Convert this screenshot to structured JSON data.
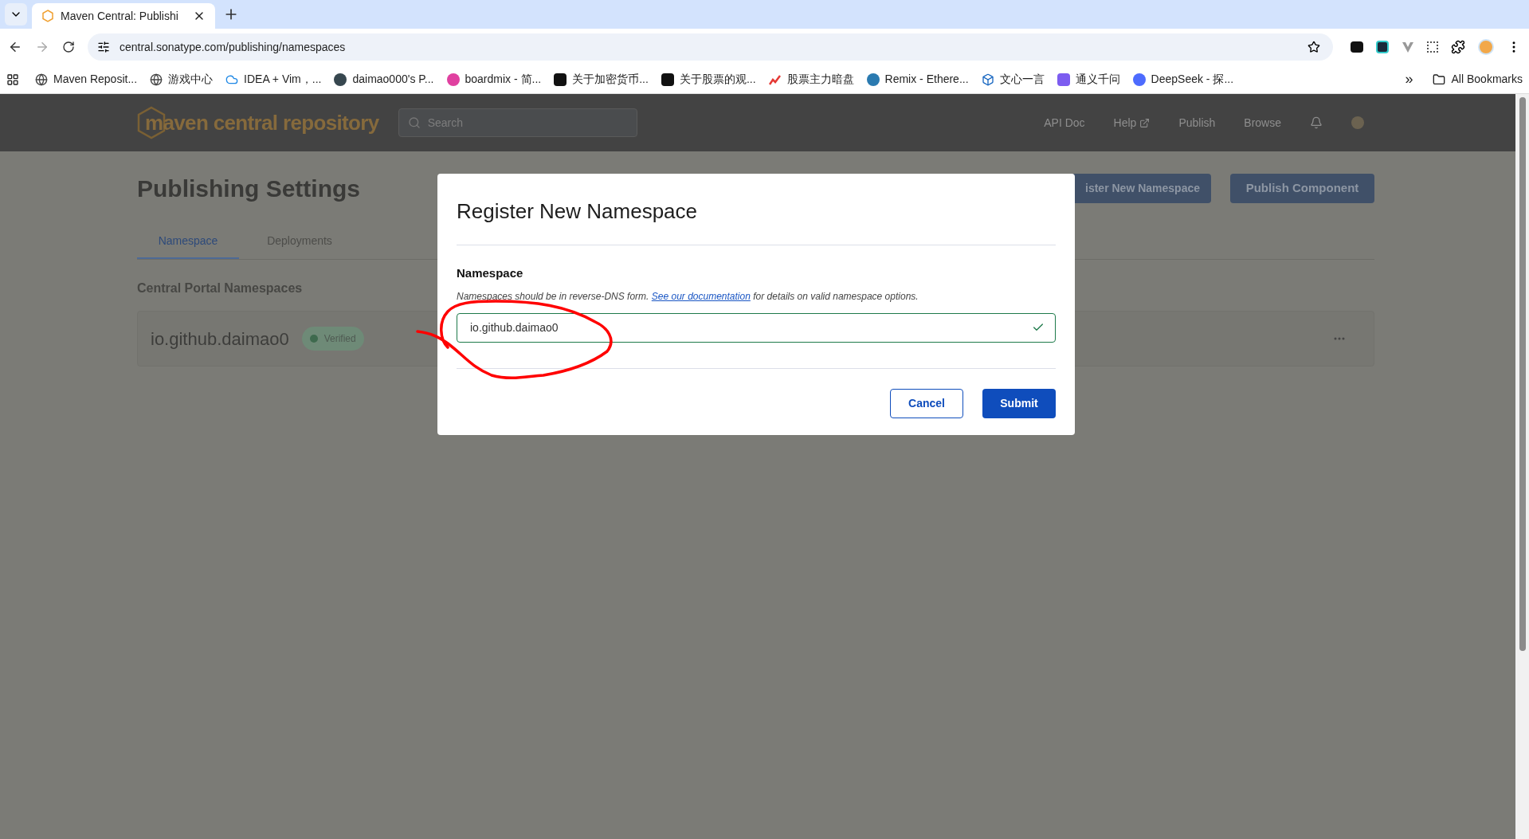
{
  "browser": {
    "tabs": [
      {
        "title": "Maven Central: Publishi",
        "selected": true
      }
    ],
    "url": "central.sonatype.com/publishing/namespaces",
    "bookmarks": [
      {
        "label": "Maven Reposit..."
      },
      {
        "label": "游戏中心"
      },
      {
        "label": "IDEA + Vim，..."
      },
      {
        "label": "daimao000's P..."
      },
      {
        "label": "boardmix - 简..."
      },
      {
        "label": "关于加密货币..."
      },
      {
        "label": "关于股票的观..."
      },
      {
        "label": "股票主力暗盘"
      },
      {
        "label": "Remix - Ethere..."
      },
      {
        "label": "文心一言"
      },
      {
        "label": "通义千问"
      },
      {
        "label": "DeepSeek - 探..."
      }
    ],
    "overflow": "»",
    "all_bookmarks": "All Bookmarks"
  },
  "site": {
    "logo": "maven central repository",
    "search_placeholder": "Search",
    "nav": [
      {
        "label": "API Doc",
        "external": false
      },
      {
        "label": "Help",
        "external": true
      },
      {
        "label": "Publish",
        "external": false
      },
      {
        "label": "Browse",
        "external": false
      }
    ],
    "page_title": "Publishing Settings",
    "actions": [
      "ister New Namespace",
      "Publish Component"
    ],
    "tabs": [
      {
        "label": "Namespace",
        "selected": true
      },
      {
        "label": "Deployments",
        "selected": false
      }
    ],
    "section_title": "Central Portal Namespaces",
    "namespaces": [
      {
        "name": "io.github.daimao0",
        "status": "Verified",
        "verified": true
      }
    ]
  },
  "modal": {
    "title": "Register New Namespace",
    "field_label": "Namespace",
    "help_before": "Namespaces should be in reverse-DNS form. ",
    "help_link": "See our documentation",
    "help_after": " for details on valid namespace options.",
    "value": "io.github.daimao0",
    "valid": true,
    "buttons": [
      {
        "label": "Cancel",
        "kind": "secondary"
      },
      {
        "label": "Submit",
        "kind": "primary"
      }
    ]
  }
}
